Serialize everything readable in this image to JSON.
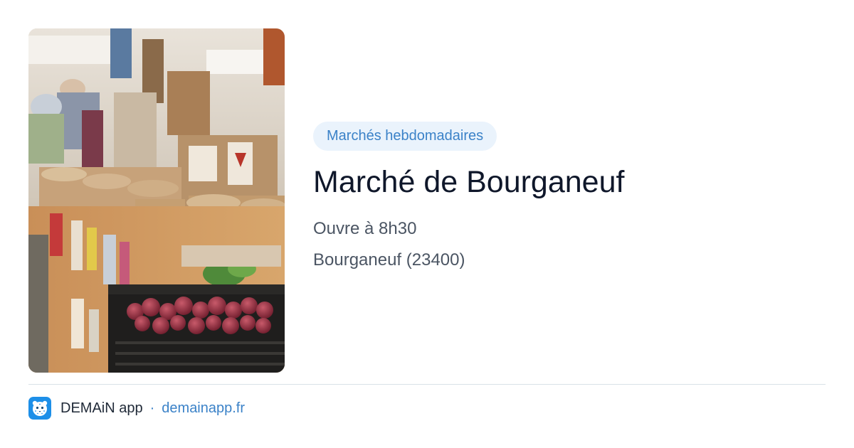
{
  "card": {
    "image_icon": "market-photo",
    "category": "Marchés hebdomadaires",
    "title": "Marché de Bourganeuf",
    "opening": "Ouvre à 8h30",
    "location": "Bourganeuf (23400)"
  },
  "footer": {
    "logo_icon": "leopard-logo-icon",
    "app_name": "DEMAiN app",
    "separator": "·",
    "link_text": "demainapp.fr"
  },
  "colors": {
    "accent": "#3b82c8",
    "badge_bg": "#eaf3fc",
    "title": "#0f172a",
    "meta": "#4b5563",
    "logo_bg": "#1d8fe8"
  }
}
